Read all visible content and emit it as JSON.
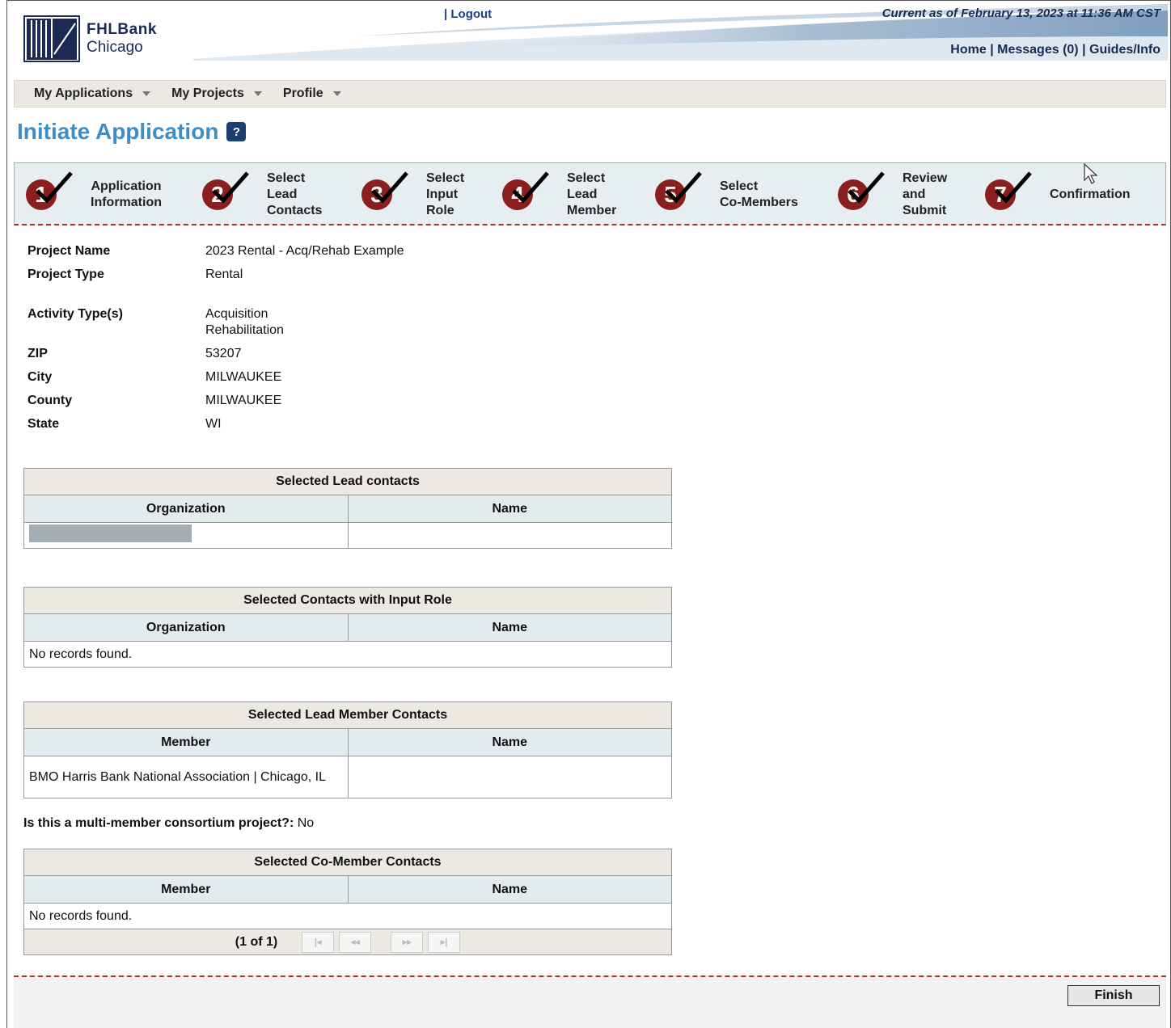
{
  "header": {
    "logo_line1": "FHLBank",
    "logo_line2": "Chicago",
    "logout": "| Logout",
    "current_as_of": "Current as of February 13, 2023 at 11:36 AM CST",
    "links": [
      "Home",
      "Messages (0)",
      "Guides/Info"
    ],
    "link_sep": " | "
  },
  "menu": [
    "My Applications",
    "My Projects",
    "Profile"
  ],
  "page_title": "Initiate Application",
  "help_icon": "?",
  "steps": [
    {
      "num": "1",
      "label": "Application\nInformation"
    },
    {
      "num": "2",
      "label": "Select\nLead\nContacts"
    },
    {
      "num": "3",
      "label": "Select\nInput\nRole"
    },
    {
      "num": "4",
      "label": "Select\nLead\nMember"
    },
    {
      "num": "5",
      "label": "Select\nCo-Members"
    },
    {
      "num": "6",
      "label": "Review\nand\nSubmit"
    },
    {
      "num": "7",
      "label": "Confirmation"
    }
  ],
  "project_info": [
    {
      "k": "Project Name",
      "v": "2023 Rental - Acq/Rehab Example"
    },
    {
      "k": "Project Type",
      "v": "Rental"
    },
    {
      "k": "Activity Type(s)",
      "v": "Acquisition\nRehabilitation"
    },
    {
      "k": "ZIP",
      "v": "53207"
    },
    {
      "k": "City",
      "v": "MILWAUKEE"
    },
    {
      "k": "County",
      "v": "MILWAUKEE"
    },
    {
      "k": "State",
      "v": "WI"
    }
  ],
  "tables": {
    "lead_contacts": {
      "caption": "Selected Lead contacts",
      "col1": "Organization",
      "col2": "Name"
    },
    "input_role": {
      "caption": "Selected Contacts with Input Role",
      "col1": "Organization",
      "col2": "Name",
      "empty": "No records found."
    },
    "lead_member": {
      "caption": "Selected Lead Member Contacts",
      "col1": "Member",
      "col2": "Name",
      "row_member": "BMO Harris Bank National Association | Chicago, IL"
    },
    "co_member": {
      "caption": "Selected Co-Member Contacts",
      "col1": "Member",
      "col2": "Name",
      "empty": "No records found.",
      "pager": "(1 of 1)"
    }
  },
  "consortium": {
    "question": "Is this a multi-member consortium project?:",
    "answer": " No"
  },
  "finish_label": "Finish"
}
